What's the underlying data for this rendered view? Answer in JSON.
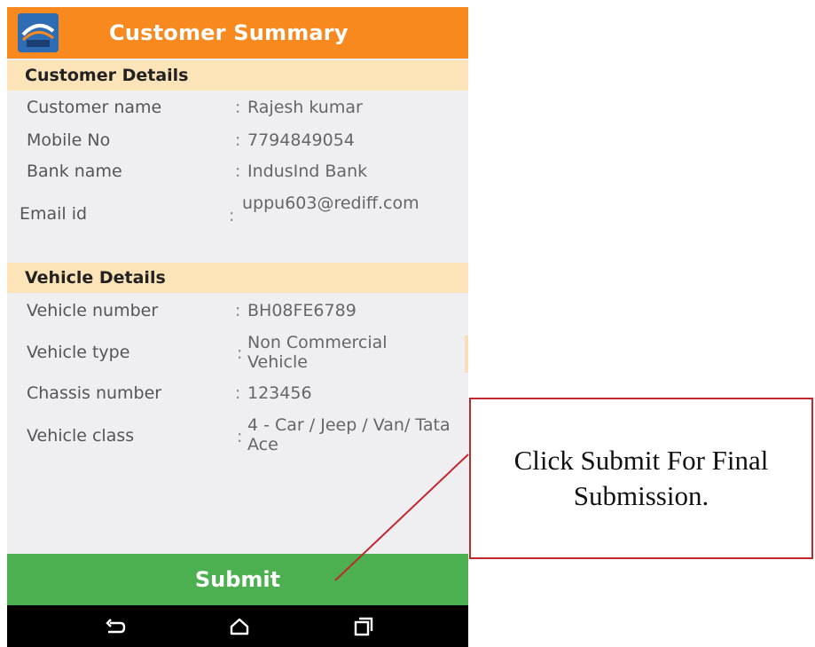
{
  "app": {
    "title": "Customer Summary",
    "logo_icon": "app-logo-icon",
    "header_color": "#f7891e"
  },
  "customer_section": {
    "title": "Customer Details",
    "rows": [
      {
        "label": "Customer name",
        "value": "Rajesh kumar"
      },
      {
        "label": "Mobile No",
        "value": "7794849054"
      },
      {
        "label": "Bank name",
        "value": "IndusInd Bank"
      },
      {
        "label": "Email id",
        "value": "uppu603@rediff.com"
      }
    ]
  },
  "vehicle_section": {
    "title": "Vehicle Details",
    "rows": [
      {
        "label": "Vehicle number",
        "value": "BH08FE6789"
      },
      {
        "label": "Vehicle type",
        "value": "Non Commercial Vehicle"
      },
      {
        "label": "Chassis number",
        "value": "123456"
      },
      {
        "label": "Vehicle class",
        "value": "4 - Car / Jeep / Van/ Tata Ace"
      }
    ]
  },
  "colon": ":",
  "submit": {
    "label": "Submit",
    "color": "#4caf50"
  },
  "navbar": {
    "back_icon": "back-icon",
    "home_icon": "home-icon",
    "recents_icon": "recents-icon"
  },
  "callout": {
    "text": "Click Submit For Final Submission.",
    "border_color": "#c0282e"
  }
}
